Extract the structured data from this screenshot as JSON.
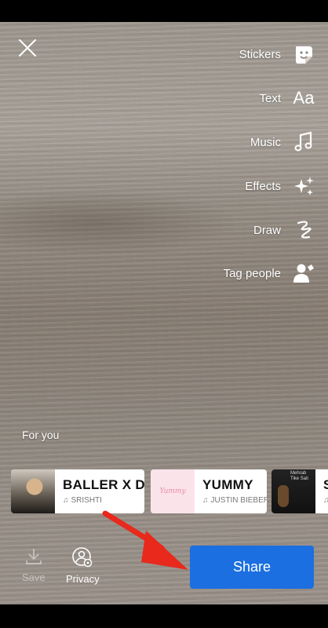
{
  "menu": {
    "stickers": "Stickers",
    "text": "Text",
    "text_icon": "Aa",
    "music": "Music",
    "effects": "Effects",
    "draw": "Draw",
    "tag_people": "Tag people"
  },
  "for_you": "For you",
  "songs": [
    {
      "title": "BALLER X DOG",
      "artist": "SRISHTI",
      "thumb_text": ""
    },
    {
      "title": "YUMMY",
      "artist": "JUSTIN BIEBER",
      "thumb_text": "Yummy"
    },
    {
      "title": "S",
      "artist": "",
      "thumb_text": "Mehrab Tike Sali"
    }
  ],
  "bottom": {
    "save": "Save",
    "privacy": "Privacy",
    "share": "Share"
  },
  "colors": {
    "share_button": "#1b6fe0",
    "annotation_arrow": "#e8291c"
  },
  "icons": [
    "close-icon",
    "sticker-icon",
    "text-icon",
    "music-note-icon",
    "sparkles-icon",
    "draw-icon",
    "tag-person-icon",
    "download-icon",
    "privacy-icon"
  ]
}
